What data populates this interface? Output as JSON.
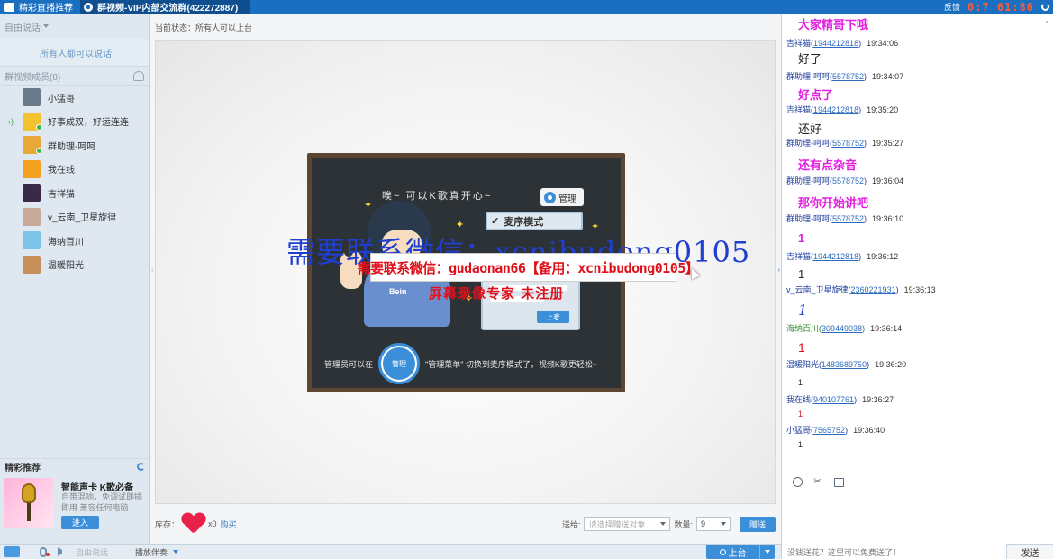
{
  "tabs": [
    {
      "label": "精彩直播推荐"
    },
    {
      "label": "群视频-VIP内部交流群(422272887)"
    }
  ],
  "topbar": {
    "right_label": "反馈",
    "timer": "0:7 61:86"
  },
  "left": {
    "mode_label": "自由说话",
    "all_can_speak": "所有人都可以说话",
    "members_header": "群视频成员(8)",
    "members": [
      {
        "name": "小猛哥",
        "color": "#6a7a8a"
      },
      {
        "name": "好事成双，好运连连",
        "color": "#f2c230"
      },
      {
        "name": "群助理-呵呵",
        "color": "#e8a838"
      },
      {
        "name": "我在线",
        "color": "#f4a020"
      },
      {
        "name": "吉祥猫",
        "color": "#3a2a4a"
      },
      {
        "name": "v_云南_卫星旋律",
        "color": "#c8a898"
      },
      {
        "name": "海纳百川",
        "color": "#7ac4e8"
      },
      {
        "name": "温暖阳光",
        "color": "#c89058"
      }
    ],
    "recommend_title": "精彩推荐",
    "recommend": {
      "name": "智能声卡 K歌必备",
      "desc": "自带混响，免调试即插即用 兼容任何电脑",
      "button": "进入"
    }
  },
  "center": {
    "status": "当前状态：所有人可以上台",
    "board": {
      "headline": "唉~ 可以K歌真开心~",
      "manage_tag": "管理",
      "mode_tag": "麦序模式",
      "up_button": "上麦",
      "shirt_text": "Bein",
      "foot_left": "管理员可以在",
      "foot_btn": "管理",
      "foot_right": "\"管理菜单\" 切换到麦序模式了，视频K歌更轻松~"
    },
    "watermark_blue": "需要联系微信：xcnibudong0105",
    "watermark_box": "需要联系微信：gudaonan66【备用：xcnibudong0105】",
    "watermark_small": "屏幕录像专家  未注册",
    "gift": {
      "stock_label": "库存：",
      "count": "x0",
      "buy": "购买",
      "give_label": "送给:",
      "target_placeholder": "请选择赠送对象",
      "qty_label": "数量:",
      "qty_value": "9",
      "give_button": "赠送"
    }
  },
  "bottom": {
    "free_speak": "自由说话",
    "accompaniment": "播放伴奏",
    "up_stage": "上台"
  },
  "chat": {
    "top_partial": "大家精哥下哦",
    "messages": [
      {
        "user": "吉祥猫",
        "uid": "1944212818",
        "time": "19:34:06",
        "text": "好了",
        "style": "plain",
        "headClass": ""
      },
      {
        "user": "群助理-呵呵",
        "uid": "5578752",
        "time": "19:34:07",
        "text": "好点了",
        "style": "mag",
        "headClass": ""
      },
      {
        "user": "吉祥猫",
        "uid": "1944212818",
        "time": "19:35:20",
        "text": "还好",
        "style": "plain",
        "headClass": ""
      },
      {
        "user": "群助理-呵呵",
        "uid": "5578752",
        "time": "19:35:27",
        "text": "还有点杂音",
        "style": "mag",
        "headClass": ""
      },
      {
        "user": "群助理-呵呵",
        "uid": "5578752",
        "time": "19:36:04",
        "text": "那你开始讲吧",
        "style": "mag",
        "headClass": ""
      },
      {
        "user": "群助理-呵呵",
        "uid": "5578752",
        "time": "19:36:10",
        "text": "1",
        "style": "mag",
        "headClass": ""
      },
      {
        "user": "吉祥猫",
        "uid": "1944212818",
        "time": "19:36:12",
        "text": "1",
        "style": "plain",
        "headClass": ""
      },
      {
        "user": "v_云南_卫星旋律",
        "uid": "2360221931",
        "time": "19:36:13",
        "text": "1",
        "style": "blue",
        "headClass": ""
      },
      {
        "user": "海纳百川",
        "uid": "309449038",
        "time": "19:36:14",
        "text": "1",
        "style": "red",
        "headClass": "green"
      },
      {
        "user": "温暖阳光",
        "uid": "1483689750",
        "time": "19:36:20",
        "text": "1",
        "style": "small",
        "headClass": ""
      },
      {
        "user": "我在线",
        "uid": "940107761",
        "time": "19:36:27",
        "text": "1",
        "style": "smallred",
        "headClass": ""
      },
      {
        "user": "小猛哥",
        "uid": "7565752",
        "time": "19:36:40",
        "text": "1",
        "style": "small",
        "headClass": ""
      }
    ],
    "input_placeholder": "没钱送花？这里可以免费送了！",
    "send": "发送"
  }
}
